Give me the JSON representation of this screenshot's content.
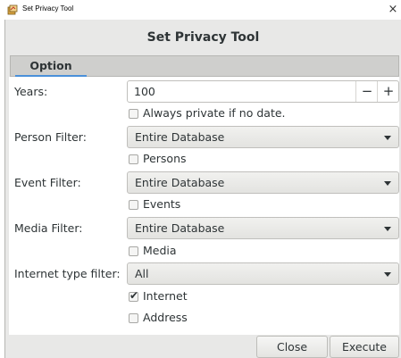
{
  "window": {
    "title": "Set Privacy Tool",
    "close_glyph": "×"
  },
  "dialog": {
    "header": "Set Privacy Tool"
  },
  "tabs": [
    {
      "label": "Option",
      "active": true
    }
  ],
  "form": {
    "years": {
      "label": "Years:",
      "value": "100",
      "minus": "−",
      "plus": "+"
    },
    "always_private": {
      "label": "Always private if no date.",
      "checked": false
    },
    "person_filter": {
      "label": "Person Filter:",
      "value": "Entire Database"
    },
    "persons": {
      "label": "Persons",
      "checked": false
    },
    "event_filter": {
      "label": "Event Filter:",
      "value": "Entire Database"
    },
    "events": {
      "label": "Events",
      "checked": false
    },
    "media_filter": {
      "label": "Media Filter:",
      "value": "Entire Database"
    },
    "media": {
      "label": "Media",
      "checked": false
    },
    "internet_filter": {
      "label": "Internet type filter:",
      "value": "All"
    },
    "internet": {
      "label": "Internet",
      "checked": true
    },
    "address": {
      "label": "Address",
      "checked": false
    }
  },
  "footer": {
    "close_label": "Close",
    "execute_label": "Execute"
  },
  "icons": {
    "app": "gramps-tool-icon",
    "checkmark": "✔"
  },
  "colors": {
    "accent": "#4a90d9",
    "background": "#e8e8e7"
  }
}
